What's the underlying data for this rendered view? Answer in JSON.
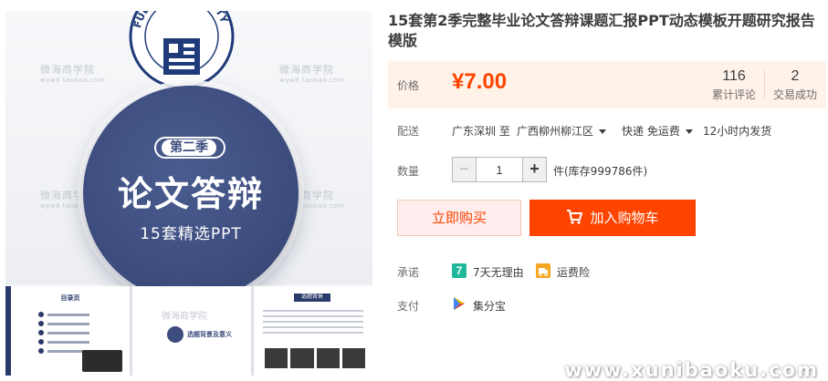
{
  "product": {
    "title": "15套第2季完整毕业论文答辩课题汇报PPT动态模板开题研究报告模版",
    "image": {
      "season_badge": "第二季",
      "main_title": "论文答辩",
      "subtitle": "15套精选PPT",
      "seal_text": "FUDAN UNIVERSITY",
      "watermark": "微海商学院",
      "watermark_url": "wyw8.taobao.com",
      "thumb1_header": "目录页",
      "thumb2_text": "选题背景及意义",
      "thumb3_header": "选题背景"
    }
  },
  "price": {
    "label": "价格",
    "value": "¥7.00",
    "reviews_count": "116",
    "reviews_label": "累计评论",
    "sales_count": "2",
    "sales_label": "交易成功"
  },
  "delivery": {
    "label": "配送",
    "from": "广东深圳 至",
    "to": "广西柳州柳江区",
    "shipping": "快递 免运费",
    "dispatch": "12小时内发货"
  },
  "quantity": {
    "label": "数量",
    "minus": "−",
    "value": "1",
    "plus": "+",
    "stock": "件(库存999786件)"
  },
  "actions": {
    "buy_now": "立即购买",
    "add_to_cart": "加入购物车"
  },
  "promise": {
    "label": "承诺",
    "return_policy": "7天无理由",
    "return_icon_text": "7",
    "shipping_insurance": "运费险"
  },
  "payment": {
    "label": "支付",
    "method": "集分宝"
  },
  "footer_watermark": "www.xunibaoku.com",
  "colors": {
    "accent": "#ff4400",
    "price_bg": "#fff2e8",
    "circle_blue": "#3d4d7e",
    "promise_green": "#1fb89a",
    "insurance_orange": "#f5a623"
  }
}
